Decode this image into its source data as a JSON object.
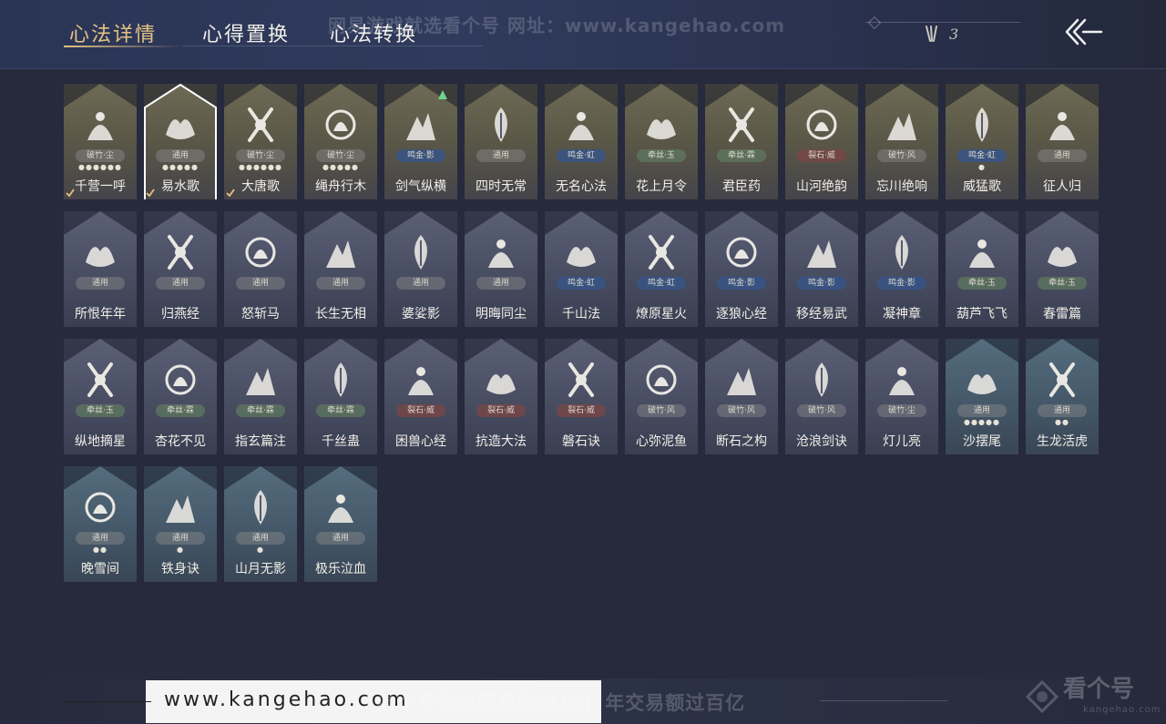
{
  "tabs": [
    {
      "label": "心法详情",
      "active": true
    },
    {
      "label": "心得置换",
      "active": false
    },
    {
      "label": "心法转换",
      "active": false
    }
  ],
  "watermark_top": "网易游戏就选看个号  网址：www.kangehao.com",
  "currency_count": "3",
  "bottom": {
    "url": "www.kangehao.com",
    "watermark": "看个号专业网易游戏八年  年交易额过百亿",
    "logo_text": "看个号",
    "logo_sub": "kangehao.com"
  },
  "accent_color": "#e6c283",
  "cards": [
    {
      "name": "千营一呼",
      "badge": "破竹·尘",
      "dots": "●●●●●●",
      "style": "gold",
      "badge_color": "gray",
      "icon": "banner-icon",
      "check": true
    },
    {
      "name": "易水歌",
      "badge": "通用",
      "dots": "●●●●●",
      "style": "gold",
      "badge_color": "gray",
      "icon": "horse-icon",
      "check": true,
      "selected": true
    },
    {
      "name": "大唐歌",
      "badge": "破竹·尘",
      "dots": "●●●●●●",
      "style": "gold",
      "badge_color": "gray",
      "icon": "palace-icon",
      "check": true
    },
    {
      "name": "绳舟行木",
      "badge": "破竹·尘",
      "dots": "●●●●●",
      "style": "gold",
      "badge_color": "gray",
      "icon": "tree-icon",
      "check": false
    },
    {
      "name": "剑气纵横",
      "badge": "鸣金·影",
      "dots": "",
      "style": "gold",
      "badge_color": "blue",
      "icon": "sword-ring-icon",
      "check": false,
      "upgrade": true
    },
    {
      "name": "四时无常",
      "badge": "通用",
      "dots": "",
      "style": "gold",
      "badge_color": "gray",
      "icon": "leaf-icon",
      "check": false
    },
    {
      "name": "无名心法",
      "badge": "鸣金·虹",
      "dots": "",
      "style": "gold",
      "badge_color": "blue",
      "icon": "sword-icon",
      "check": false
    },
    {
      "name": "花上月令",
      "badge": "牵丝·玉",
      "dots": "",
      "style": "gold",
      "badge_color": "green",
      "icon": "moon-flower-icon",
      "check": false
    },
    {
      "name": "君臣药",
      "badge": "牵丝·霖",
      "dots": "",
      "style": "gold",
      "badge_color": "green",
      "icon": "herb-icon",
      "check": false
    },
    {
      "name": "山河绝韵",
      "badge": "裂石·威",
      "dots": "",
      "style": "gold",
      "badge_color": "red",
      "icon": "mountain-icon",
      "check": false
    },
    {
      "name": "忘川绝响",
      "badge": "破竹·风",
      "dots": "",
      "style": "gold",
      "badge_color": "gray",
      "icon": "mask-icon",
      "check": false
    },
    {
      "name": "威猛歌",
      "badge": "鸣金·虹",
      "dots": "●",
      "style": "gold",
      "badge_color": "blue",
      "icon": "hands-icon",
      "check": false
    },
    {
      "name": "征人归",
      "badge": "通用",
      "dots": "",
      "style": "gold",
      "badge_color": "gray",
      "icon": "bird-icon",
      "check": false
    },
    {
      "name": "所恨年年",
      "badge": "通用",
      "dots": "",
      "style": "plain",
      "badge_color": "gray",
      "icon": "willow-icon",
      "check": false
    },
    {
      "name": "归燕经",
      "badge": "通用",
      "dots": "",
      "style": "plain",
      "badge_color": "gray",
      "icon": "swallow-icon",
      "check": false
    },
    {
      "name": "怒斩马",
      "badge": "通用",
      "dots": "",
      "style": "plain",
      "badge_color": "gray",
      "icon": "blade-icon",
      "check": false
    },
    {
      "name": "长生无相",
      "badge": "通用",
      "dots": "",
      "style": "plain",
      "badge_color": "gray",
      "icon": "statue-icon",
      "check": false
    },
    {
      "name": "婆娑影",
      "badge": "通用",
      "dots": "",
      "style": "plain",
      "badge_color": "gray",
      "icon": "dragon-icon",
      "check": false
    },
    {
      "name": "明晦同尘",
      "badge": "通用",
      "dots": "",
      "style": "plain",
      "badge_color": "gray",
      "icon": "knot-icon",
      "check": false
    },
    {
      "name": "千山法",
      "badge": "鸣金·虹",
      "dots": "",
      "style": "plain",
      "badge_color": "blue",
      "icon": "peaks-icon",
      "check": false
    },
    {
      "name": "燎原星火",
      "badge": "鸣金·虹",
      "dots": "",
      "style": "plain",
      "badge_color": "blue",
      "icon": "scythe-icon",
      "check": false
    },
    {
      "name": "逐狼心经",
      "badge": "鸣金·影",
      "dots": "",
      "style": "plain",
      "badge_color": "blue",
      "icon": "wolf-icon",
      "check": false
    },
    {
      "name": "移经易武",
      "badge": "鸣金·影",
      "dots": "",
      "style": "plain",
      "badge_color": "blue",
      "icon": "armor-icon",
      "check": false
    },
    {
      "name": "凝神章",
      "badge": "鸣金·影",
      "dots": "",
      "style": "plain",
      "badge_color": "blue",
      "icon": "bow-icon",
      "check": false
    },
    {
      "name": "葫芦飞飞",
      "badge": "牵丝·玉",
      "dots": "",
      "style": "plain",
      "badge_color": "green",
      "icon": "gourd-icon",
      "check": false
    },
    {
      "name": "春雷篇",
      "badge": "牵丝·玉",
      "dots": "",
      "style": "plain",
      "badge_color": "green",
      "icon": "thunder-tree-icon",
      "check": false
    },
    {
      "name": "纵地摘星",
      "badge": "牵丝·玉",
      "dots": "",
      "style": "plain",
      "badge_color": "green",
      "icon": "star-hand-icon",
      "check": false
    },
    {
      "name": "杏花不见",
      "badge": "牵丝·霖",
      "dots": "",
      "style": "plain",
      "badge_color": "green",
      "icon": "blossom-icon",
      "check": false
    },
    {
      "name": "指玄篇注",
      "badge": "牵丝·霖",
      "dots": "",
      "style": "plain",
      "badge_color": "green",
      "icon": "yinyang-icon",
      "check": false
    },
    {
      "name": "千丝蛊",
      "badge": "牵丝·霖",
      "dots": "",
      "style": "plain",
      "badge_color": "green",
      "icon": "feather-icon",
      "check": false
    },
    {
      "name": "困兽心经",
      "badge": "裂石·威",
      "dots": "",
      "style": "plain",
      "badge_color": "red",
      "icon": "drum-icon",
      "check": false
    },
    {
      "name": "抗造大法",
      "badge": "裂石·威",
      "dots": "",
      "style": "plain",
      "badge_color": "red",
      "icon": "bell-icon",
      "check": false
    },
    {
      "name": "磐石诀",
      "badge": "裂石·威",
      "dots": "",
      "style": "plain",
      "badge_color": "red",
      "icon": "rock-icon",
      "check": false
    },
    {
      "name": "心弥泥鱼",
      "badge": "破竹·风",
      "dots": "",
      "style": "plain",
      "badge_color": "gray",
      "icon": "fish-icon",
      "check": false
    },
    {
      "name": "断石之构",
      "badge": "破竹·风",
      "dots": "",
      "style": "plain",
      "badge_color": "gray",
      "icon": "warrior-icon",
      "check": false
    },
    {
      "name": "沧浪剑诀",
      "badge": "破竹·风",
      "dots": "",
      "style": "plain",
      "badge_color": "gray",
      "icon": "serpent-icon",
      "check": false
    },
    {
      "name": "灯儿亮",
      "badge": "破竹·尘",
      "dots": "",
      "style": "plain",
      "badge_color": "gray",
      "icon": "lantern-icon",
      "check": false
    },
    {
      "name": "沙摆尾",
      "badge": "通用",
      "dots": "●●●●●",
      "style": "teal",
      "badge_color": "gray",
      "icon": "wave-icon",
      "check": false
    },
    {
      "name": "生龙活虎",
      "badge": "通用",
      "dots": "●●",
      "style": "teal",
      "badge_color": "gray",
      "icon": "cross-swirl-icon",
      "check": false
    },
    {
      "name": "晚雪间",
      "badge": "通用",
      "dots": "●●",
      "style": "teal",
      "badge_color": "gray",
      "icon": "cross-icon",
      "check": false
    },
    {
      "name": "铁身诀",
      "badge": "通用",
      "dots": "●",
      "style": "teal",
      "badge_color": "gray",
      "icon": "muscle-icon",
      "check": false
    },
    {
      "name": "山月无影",
      "badge": "通用",
      "dots": "●",
      "style": "teal",
      "badge_color": "gray",
      "icon": "slash-icon",
      "check": false
    },
    {
      "name": "极乐泣血",
      "badge": "通用",
      "dots": "",
      "style": "teal",
      "badge_color": "gray",
      "icon": "claw-icon",
      "check": false
    }
  ]
}
